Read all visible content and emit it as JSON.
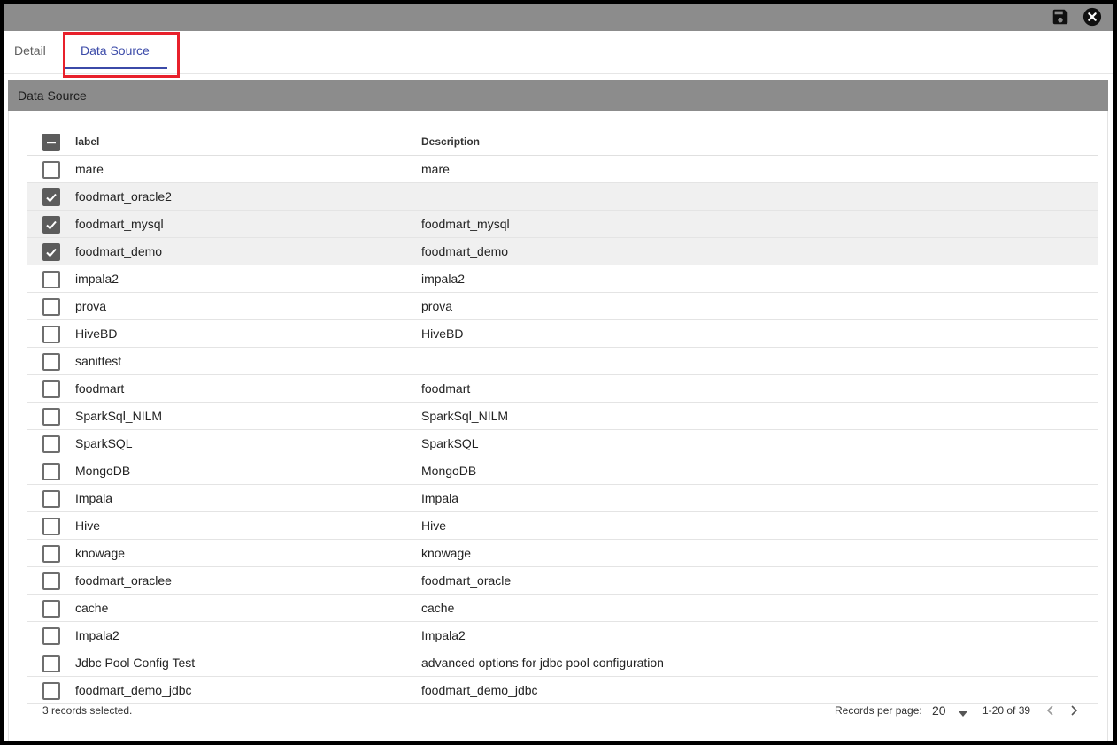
{
  "tabs": [
    {
      "label": "Detail",
      "active": false
    },
    {
      "label": "Data Source",
      "active": true
    }
  ],
  "section": {
    "title": "Data Source"
  },
  "table": {
    "columns": {
      "label": "label",
      "description": "Description"
    },
    "header_checkbox_state": "indeterminate",
    "rows": [
      {
        "label": "mare",
        "description": "mare",
        "checked": false
      },
      {
        "label": "foodmart_oracle2",
        "description": "",
        "checked": true
      },
      {
        "label": "foodmart_mysql",
        "description": "foodmart_mysql",
        "checked": true
      },
      {
        "label": "foodmart_demo",
        "description": "foodmart_demo",
        "checked": true
      },
      {
        "label": "impala2",
        "description": "impala2",
        "checked": false
      },
      {
        "label": "prova",
        "description": "prova",
        "checked": false
      },
      {
        "label": "HiveBD",
        "description": "HiveBD",
        "checked": false
      },
      {
        "label": "sanittest",
        "description": "",
        "checked": false
      },
      {
        "label": "foodmart",
        "description": "foodmart",
        "checked": false
      },
      {
        "label": "SparkSql_NILM",
        "description": "SparkSql_NILM",
        "checked": false
      },
      {
        "label": "SparkSQL",
        "description": "SparkSQL",
        "checked": false
      },
      {
        "label": "MongoDB",
        "description": "MongoDB",
        "checked": false
      },
      {
        "label": "Impala",
        "description": "Impala",
        "checked": false
      },
      {
        "label": "Hive",
        "description": "Hive",
        "checked": false
      },
      {
        "label": "knowage",
        "description": "knowage",
        "checked": false
      },
      {
        "label": "foodmart_oraclee",
        "description": "foodmart_oracle",
        "checked": false
      },
      {
        "label": "cache",
        "description": "cache",
        "checked": false
      },
      {
        "label": "Impala2",
        "description": "Impala2",
        "checked": false
      },
      {
        "label": "Jdbc Pool Config Test",
        "description": "advanced options for jdbc pool configuration",
        "checked": false
      },
      {
        "label": "foodmart_demo_jdbc",
        "description": "foodmart_demo_jdbc",
        "checked": false
      }
    ]
  },
  "footer": {
    "selected_text": "3 records selected.",
    "records_per_page_label": "Records per page:",
    "records_per_page_value": "20",
    "range_text": "1-20 of 39"
  },
  "icons": {
    "save": "floppy-disk-icon",
    "close": "close-circle-icon",
    "caret": "caret-down-icon",
    "prev": "chevron-left-icon",
    "next": "chevron-right-icon"
  },
  "colors": {
    "accent": "#3b4aa8",
    "highlight": "#e8202b",
    "toolbar": "#8c8c8c"
  }
}
